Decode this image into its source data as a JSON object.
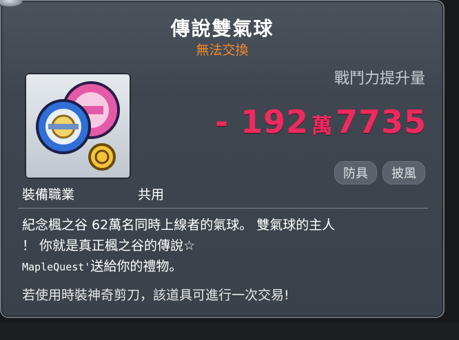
{
  "item": {
    "name": "傳說雙氣球",
    "trade_status": "無法交換"
  },
  "power": {
    "label": "戰鬥力提升量",
    "sign": "-",
    "value_main": "192",
    "unit": "萬",
    "value_rest": "7735",
    "color": "#ee2a5e"
  },
  "tags": [
    "防具",
    "披風"
  ],
  "job": {
    "label": "裝備職業",
    "value": "共用"
  },
  "description": {
    "line1": "紀念楓之谷 62萬名同時上線者的氣球。 雙氣球的主人",
    "line2": "！ 你就是真正楓之谷的傳說☆",
    "line3_mono": "MapleQuest'",
    "line3_rest": "送給你的禮物。"
  },
  "note": "若使用時裝神奇剪刀，該道具可進行一次交易!",
  "icon": "twin-balloons-icon",
  "colors": {
    "title": "#ffffff",
    "trade_status": "#f08a2f",
    "panel": "#3f464f"
  }
}
